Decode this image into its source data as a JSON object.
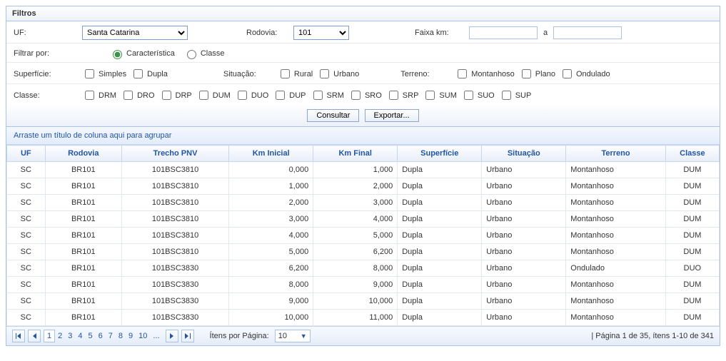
{
  "panel_title": "Filtros",
  "labels": {
    "uf": "UF:",
    "rodovia": "Rodovia:",
    "faixa_km": "Faixa km:",
    "a": "a",
    "filtrar_por": "Filtrar por:",
    "superficie": "Superfície:",
    "situacao": "Situação:",
    "terreno": "Terreno:",
    "classe": "Classe:"
  },
  "uf_select": "Santa Catarina",
  "rodovia_select": "101",
  "filtrar_opts": {
    "caracteristica": "Característica",
    "classe": "Classe"
  },
  "superficie_opts": [
    "Simples",
    "Dupla"
  ],
  "situacao_opts": [
    "Rural",
    "Urbano"
  ],
  "terreno_opts": [
    "Montanhoso",
    "Plano",
    "Ondulado"
  ],
  "classe_opts": [
    "DRM",
    "DRO",
    "DRP",
    "DUM",
    "DUO",
    "DUP",
    "SRM",
    "SRO",
    "SRP",
    "SUM",
    "SUO",
    "SUP"
  ],
  "buttons": {
    "consultar": "Consultar",
    "exportar": "Exportar..."
  },
  "groupbar": "Arraste um título de coluna aqui para agrupar",
  "columns": {
    "uf": "UF",
    "rodovia": "Rodovia",
    "trecho": "Trecho PNV",
    "kmi": "Km Inicial",
    "kmf": "Km Final",
    "sup": "Superfície",
    "sit": "Situação",
    "ter": "Terreno",
    "cls": "Classe"
  },
  "rows": [
    {
      "uf": "SC",
      "rod": "BR101",
      "trecho": "101BSC3810",
      "kmi": "0,000",
      "kmf": "1,000",
      "sup": "Dupla",
      "sit": "Urbano",
      "ter": "Montanhoso",
      "cls": "DUM"
    },
    {
      "uf": "SC",
      "rod": "BR101",
      "trecho": "101BSC3810",
      "kmi": "1,000",
      "kmf": "2,000",
      "sup": "Dupla",
      "sit": "Urbano",
      "ter": "Montanhoso",
      "cls": "DUM"
    },
    {
      "uf": "SC",
      "rod": "BR101",
      "trecho": "101BSC3810",
      "kmi": "2,000",
      "kmf": "3,000",
      "sup": "Dupla",
      "sit": "Urbano",
      "ter": "Montanhoso",
      "cls": "DUM"
    },
    {
      "uf": "SC",
      "rod": "BR101",
      "trecho": "101BSC3810",
      "kmi": "3,000",
      "kmf": "4,000",
      "sup": "Dupla",
      "sit": "Urbano",
      "ter": "Montanhoso",
      "cls": "DUM"
    },
    {
      "uf": "SC",
      "rod": "BR101",
      "trecho": "101BSC3810",
      "kmi": "4,000",
      "kmf": "5,000",
      "sup": "Dupla",
      "sit": "Urbano",
      "ter": "Montanhoso",
      "cls": "DUM"
    },
    {
      "uf": "SC",
      "rod": "BR101",
      "trecho": "101BSC3810",
      "kmi": "5,000",
      "kmf": "6,200",
      "sup": "Dupla",
      "sit": "Urbano",
      "ter": "Montanhoso",
      "cls": "DUM"
    },
    {
      "uf": "SC",
      "rod": "BR101",
      "trecho": "101BSC3830",
      "kmi": "6,200",
      "kmf": "8,000",
      "sup": "Dupla",
      "sit": "Urbano",
      "ter": "Ondulado",
      "cls": "DUO"
    },
    {
      "uf": "SC",
      "rod": "BR101",
      "trecho": "101BSC3830",
      "kmi": "8,000",
      "kmf": "9,000",
      "sup": "Dupla",
      "sit": "Urbano",
      "ter": "Montanhoso",
      "cls": "DUM"
    },
    {
      "uf": "SC",
      "rod": "BR101",
      "trecho": "101BSC3830",
      "kmi": "9,000",
      "kmf": "10,000",
      "sup": "Dupla",
      "sit": "Urbano",
      "ter": "Montanhoso",
      "cls": "DUM"
    },
    {
      "uf": "SC",
      "rod": "BR101",
      "trecho": "101BSC3830",
      "kmi": "10,000",
      "kmf": "11,000",
      "sup": "Dupla",
      "sit": "Urbano",
      "ter": "Montanhoso",
      "cls": "DUM"
    }
  ],
  "pager": {
    "pages": [
      "1",
      "2",
      "3",
      "4",
      "5",
      "6",
      "7",
      "8",
      "9",
      "10",
      "..."
    ],
    "current": "1",
    "itens_label": "Ítens por Página:",
    "page_size": "10",
    "info": "| Página 1 de 35, ítens 1-10 de 341"
  }
}
